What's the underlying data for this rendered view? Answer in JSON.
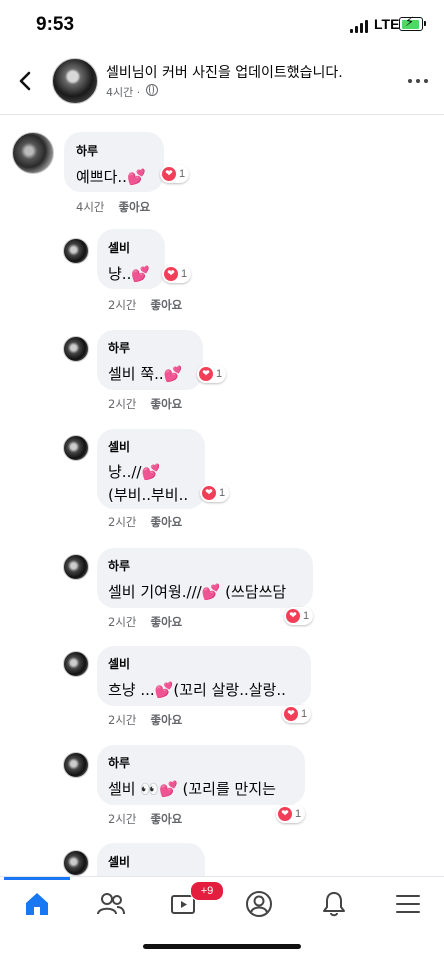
{
  "status_bar": {
    "time": "9:53",
    "network": "LTE"
  },
  "header": {
    "title": "셀비님이 커버 사진을 업데이트했습니다.",
    "subtitle": "4시간 · "
  },
  "comments": [
    {
      "author": "하루",
      "text": "예쁘다..",
      "emoji": "💕",
      "reaction_count": "1",
      "time": "4시간",
      "like_label": "좋아요"
    },
    {
      "author": "셀비",
      "text": "냥..",
      "emoji": "💕",
      "reaction_count": "1",
      "time": "2시간",
      "like_label": "좋아요"
    },
    {
      "author": "하루",
      "text": "셀비 쭉..",
      "emoji": "💕",
      "reaction_count": "1",
      "time": "2시간",
      "like_label": "좋아요"
    },
    {
      "author": "셀비",
      "text": "냥..//",
      "emoji": "💕",
      "text2": "(부비..부비..",
      "reaction_count": "1",
      "time": "2시간",
      "like_label": "좋아요"
    },
    {
      "author": "하루",
      "text": "셀비 기여웡.///",
      "emoji": "💕",
      "text_after": " (쓰담쓰담",
      "reaction_count": "1",
      "time": "2시간",
      "like_label": "좋아요"
    },
    {
      "author": "셀비",
      "text": "흐냥 ...",
      "emoji": "💕",
      "text_after": "(꼬리 살랑..살랑..",
      "reaction_count": "1",
      "time": "2시간",
      "like_label": "좋아요"
    },
    {
      "author": "하루",
      "text": "셀비 👀",
      "emoji": "💕",
      "text_after": " (꼬리를 만지는",
      "reaction_count": "1",
      "time": "2시간",
      "like_label": "좋아요"
    },
    {
      "author": "셀비"
    }
  ],
  "bottom_nav": {
    "items": [
      "home-icon",
      "friends-icon",
      "watch-icon",
      "profile-icon",
      "notifications-icon",
      "menu-icon"
    ],
    "watch_badge": "+9",
    "active": "home",
    "accent": "#1877f2"
  }
}
